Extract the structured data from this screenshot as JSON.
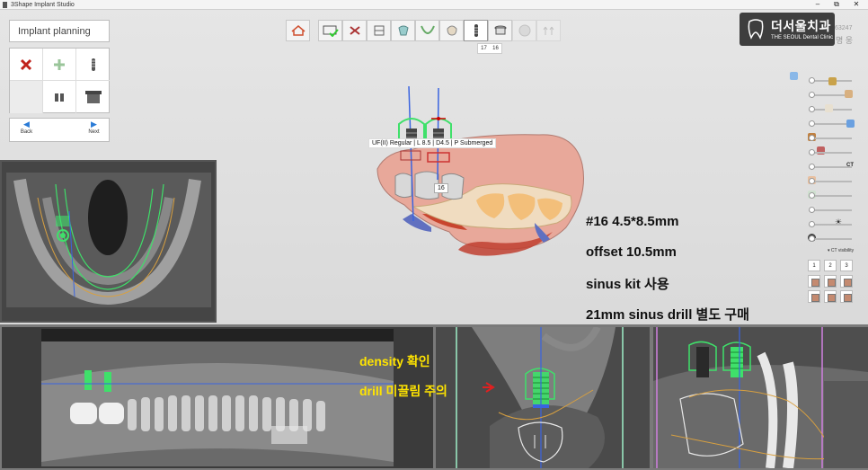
{
  "window": {
    "title": "3Shape Implant Studio",
    "controls": [
      "–",
      "⧉",
      "✕"
    ]
  },
  "left_panel": {
    "title": "Implant planning",
    "tools": [
      "delete-icon",
      "add-implant-icon",
      "implant-icon",
      "empty",
      "abutment-icon",
      "sleeve-icon"
    ],
    "nav": {
      "back": "Back",
      "next": "Next"
    }
  },
  "top_toolbar": {
    "items": [
      "home-icon",
      "order-icon",
      "bone-icon",
      "scan-icon",
      "prep-icon",
      "gum-icon",
      "crown-icon",
      "implant-icon",
      "sleeve-icon",
      "guide-icon",
      "finish-icon"
    ],
    "active_index": 7,
    "tooth_selector": [
      "17",
      "16"
    ]
  },
  "logo": {
    "korean": "더서울치과",
    "english": "THE SEOUL Dental Clinic"
  },
  "patient": {
    "id_partial": "63247",
    "name_partial": "명 웅"
  },
  "right_panel": {
    "ct_label": "CT",
    "ct_visibility_label": "CT visibility",
    "view_numbers": [
      "1",
      "2",
      "3"
    ]
  },
  "model_view": {
    "implant_label": "UF(II) Regular | L 8.5 | D4.5 | P Submerged",
    "tooth_label": "16"
  },
  "annotations": {
    "main": [
      "#16 4.5*8.5mm",
      "offset 10.5mm",
      "sinus kit 사용",
      "21mm sinus drill 별도 구매"
    ],
    "bottom": [
      "density 확인",
      "drill 미끌림 주의"
    ]
  },
  "colors": {
    "implant_green": "#3fe06a",
    "annotation_yellow": "#ffe400",
    "arrow_red": "#e02020",
    "axis_blue": "#3a64e0",
    "accent_blue": "#2a7bd6"
  }
}
